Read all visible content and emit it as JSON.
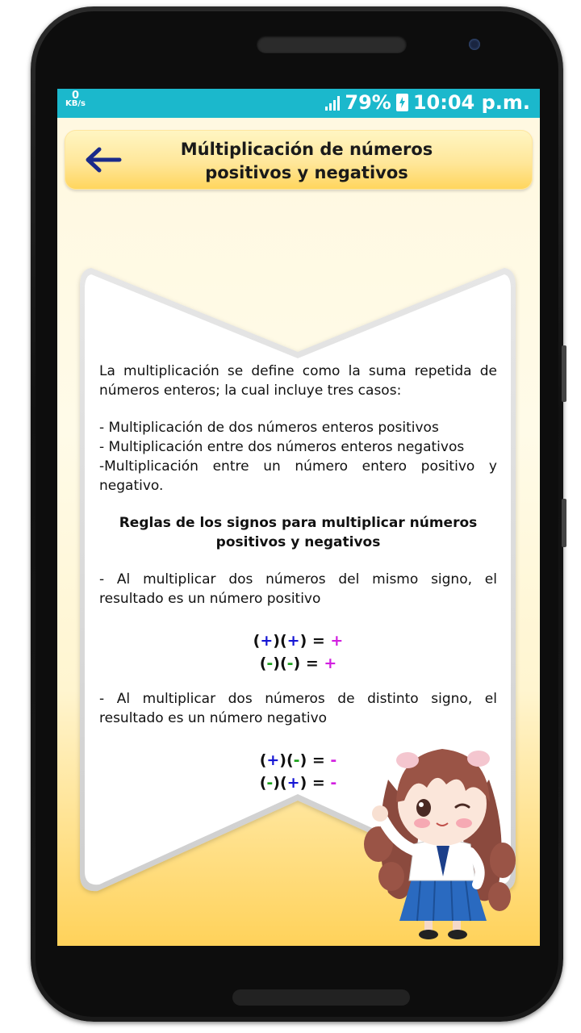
{
  "status_bar": {
    "speed_value": "0",
    "speed_unit": "KB/s",
    "battery": "79%",
    "time": "10:04 p.m."
  },
  "header": {
    "title_line1": "Múltiplicación de números",
    "title_line2": "positivos y negativos",
    "back_icon": "arrow-left-icon"
  },
  "content": {
    "intro": "La multiplicación se define como la suma repetida de números enteros; la cual incluye tres casos:",
    "case1": "- Multiplicación de dos números enteros positivos",
    "case2": "- Multiplicación entre dos números enteros negativos",
    "case3": "-Multiplicación entre un número entero positivo y negativo.",
    "rules_heading": "Reglas de los signos para multiplicar números positivos y negativos",
    "rule_same": "- Al multiplicar dos números del mismo signo, el resultado es un número positivo",
    "rule_diff": "- Al multiplicar dos números de distinto signo, el resultado es un número negativo"
  },
  "formulas": {
    "open": "(",
    "close": ")",
    "equals": " = ",
    "plus": "+",
    "minus": "-"
  },
  "colors": {
    "status_bar": "#1bb8cc",
    "positive_sign": "#1515d4",
    "negative_sign": "#18a018",
    "result_sign": "#d21fe0",
    "arrow": "#1a2a8a"
  }
}
